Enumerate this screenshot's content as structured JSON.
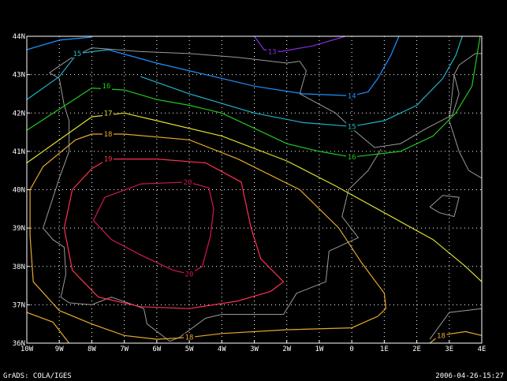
{
  "footer": {
    "left": "GrADS: COLA/IGES",
    "right": "2006-04-26-15:27"
  },
  "colors": {
    "background": "#000000",
    "frame": "#ffffff",
    "grid": "#ffffff",
    "coastline": "#9a9a9a",
    "levels": {
      "13": "#8a2be2",
      "14": "#1e90ff",
      "15": "#20b2c8",
      "16": "#22c81e",
      "17": "#dede2c",
      "18": "#e6a92c",
      "19": "#ff3050",
      "20": "#d11a4a"
    }
  },
  "chart_data": {
    "type": "contour",
    "title": "",
    "xlabel": "",
    "ylabel": "",
    "xlim": [
      -10,
      4
    ],
    "ylim": [
      36,
      44
    ],
    "grid": true,
    "x_ticks": [
      {
        "value": -10,
        "label": "10W"
      },
      {
        "value": -9,
        "label": "9W"
      },
      {
        "value": -8,
        "label": "8W"
      },
      {
        "value": -7,
        "label": "7W"
      },
      {
        "value": -6,
        "label": "6W"
      },
      {
        "value": -5,
        "label": "5W"
      },
      {
        "value": -4,
        "label": "4W"
      },
      {
        "value": -3,
        "label": "3W"
      },
      {
        "value": -2,
        "label": "2W"
      },
      {
        "value": -1,
        "label": "1W"
      },
      {
        "value": 0,
        "label": "0"
      },
      {
        "value": 1,
        "label": "1E"
      },
      {
        "value": 2,
        "label": "2E"
      },
      {
        "value": 3,
        "label": "3E"
      },
      {
        "value": 4,
        "label": "4E"
      }
    ],
    "y_ticks": [
      {
        "value": 36,
        "label": "36N"
      },
      {
        "value": 37,
        "label": "37N"
      },
      {
        "value": 38,
        "label": "38N"
      },
      {
        "value": 39,
        "label": "39N"
      },
      {
        "value": 40,
        "label": "40N"
      },
      {
        "value": 41,
        "label": "41N"
      },
      {
        "value": 42,
        "label": "42N"
      },
      {
        "value": 43,
        "label": "43N"
      },
      {
        "value": 44,
        "label": "44N"
      }
    ],
    "contours": [
      {
        "level": "13",
        "label": "13",
        "labels_at": [
          [
            -2.45,
            43.6
          ]
        ],
        "paths": [
          [
            [
              -3.0,
              44.0
            ],
            [
              -2.7,
              43.65
            ],
            [
              -2.2,
              43.6
            ],
            [
              -1.2,
              43.75
            ],
            [
              -0.2,
              44.0
            ]
          ]
        ]
      },
      {
        "level": "14",
        "label": "14",
        "labels_at": [
          [
            0.0,
            42.45
          ]
        ],
        "paths": [
          [
            [
              -10.0,
              43.65
            ],
            [
              -9.0,
              43.9
            ],
            [
              -8.0,
              43.98
            ]
          ],
          [
            [
              -7.5,
              43.65
            ],
            [
              -6.0,
              43.3
            ],
            [
              -4.5,
              43.0
            ],
            [
              -3.0,
              42.7
            ],
            [
              -1.5,
              42.5
            ],
            [
              0.0,
              42.45
            ],
            [
              0.5,
              42.55
            ],
            [
              0.8,
              42.9
            ],
            [
              1.2,
              43.5
            ],
            [
              1.45,
              44.0
            ]
          ]
        ]
      },
      {
        "level": "15",
        "label": "15",
        "labels_at": [
          [
            -8.45,
            43.55
          ],
          [
            0.0,
            41.65
          ]
        ],
        "paths": [
          [
            [
              -10.0,
              42.35
            ],
            [
              -9.0,
              42.95
            ],
            [
              -8.45,
              43.55
            ],
            [
              -7.5,
              43.65
            ]
          ],
          [
            [
              -6.5,
              42.95
            ],
            [
              -5.0,
              42.5
            ],
            [
              -3.0,
              42.0
            ],
            [
              -1.5,
              41.75
            ],
            [
              0.0,
              41.65
            ],
            [
              1.0,
              41.8
            ],
            [
              2.0,
              42.2
            ],
            [
              2.8,
              42.9
            ],
            [
              3.2,
              43.5
            ],
            [
              3.4,
              44.0
            ]
          ]
        ]
      },
      {
        "level": "16",
        "label": "16",
        "labels_at": [
          [
            -7.55,
            42.7
          ],
          [
            0.0,
            40.85
          ]
        ],
        "paths": [
          [
            [
              -10.0,
              41.55
            ],
            [
              -9.0,
              42.1
            ],
            [
              -8.0,
              42.65
            ],
            [
              -7.0,
              42.6
            ],
            [
              -6.0,
              42.35
            ],
            [
              -5.0,
              42.2
            ],
            [
              -4.0,
              42.0
            ],
            [
              -3.0,
              41.6
            ],
            [
              -2.0,
              41.2
            ],
            [
              -1.0,
              41.0
            ],
            [
              0.0,
              40.85
            ],
            [
              1.5,
              41.0
            ],
            [
              2.5,
              41.4
            ],
            [
              3.2,
              42.0
            ],
            [
              3.7,
              42.7
            ],
            [
              3.95,
              44.0
            ]
          ]
        ]
      },
      {
        "level": "17",
        "label": "17",
        "labels_at": [
          [
            -7.5,
            42.0
          ]
        ],
        "paths": [
          [
            [
              -10.0,
              40.7
            ],
            [
              -9.0,
              41.3
            ],
            [
              -8.0,
              41.9
            ],
            [
              -7.0,
              42.0
            ],
            [
              -6.0,
              41.8
            ],
            [
              -4.0,
              41.4
            ],
            [
              -2.0,
              40.75
            ],
            [
              -0.5,
              40.1
            ],
            [
              1.0,
              39.4
            ],
            [
              2.5,
              38.7
            ],
            [
              3.5,
              38.0
            ],
            [
              4.0,
              37.6
            ]
          ]
        ]
      },
      {
        "level": "18",
        "label": "18",
        "labels_at": [
          [
            -7.5,
            41.45
          ],
          [
            -5.0,
            36.15
          ],
          [
            2.75,
            36.2
          ]
        ],
        "paths": [
          [
            [
              -8.0,
              41.45
            ],
            [
              -7.0,
              41.45
            ],
            [
              -5.0,
              41.3
            ],
            [
              -3.5,
              40.8
            ],
            [
              -1.6,
              40.0
            ],
            [
              -0.4,
              39.0
            ],
            [
              0.3,
              38.1
            ],
            [
              1.0,
              37.3
            ],
            [
              1.05,
              36.9
            ],
            [
              0.8,
              36.7
            ],
            [
              0.0,
              36.4
            ],
            [
              -2.0,
              36.35
            ],
            [
              -4.0,
              36.25
            ],
            [
              -5.0,
              36.15
            ],
            [
              -6.0,
              36.1
            ],
            [
              -7.0,
              36.2
            ],
            [
              -8.0,
              36.5
            ],
            [
              -9.0,
              36.85
            ],
            [
              -9.8,
              37.6
            ],
            [
              -9.9,
              38.8
            ],
            [
              -9.9,
              40.0
            ],
            [
              -9.5,
              40.6
            ],
            [
              -8.5,
              41.3
            ],
            [
              -8.0,
              41.45
            ]
          ],
          [
            [
              -10.0,
              36.8
            ],
            [
              -9.2,
              36.55
            ],
            [
              -8.7,
              36.0
            ]
          ],
          [
            [
              2.4,
              36.0
            ],
            [
              2.7,
              36.2
            ],
            [
              3.5,
              36.3
            ],
            [
              4.0,
              36.2
            ]
          ]
        ]
      },
      {
        "level": "19",
        "label": "19",
        "labels_at": [
          [
            -7.5,
            40.8
          ]
        ],
        "paths": [
          [
            [
              -7.5,
              40.8
            ],
            [
              -6.0,
              40.8
            ],
            [
              -4.5,
              40.7
            ],
            [
              -3.4,
              40.2
            ],
            [
              -3.1,
              39.0
            ],
            [
              -2.8,
              38.2
            ],
            [
              -2.1,
              37.6
            ],
            [
              -2.5,
              37.35
            ],
            [
              -3.5,
              37.1
            ],
            [
              -5.0,
              36.9
            ],
            [
              -6.5,
              36.95
            ],
            [
              -7.8,
              37.2
            ],
            [
              -8.6,
              37.9
            ],
            [
              -8.85,
              39.0
            ],
            [
              -8.6,
              40.0
            ],
            [
              -8.0,
              40.55
            ],
            [
              -7.5,
              40.8
            ]
          ]
        ]
      },
      {
        "level": "20",
        "label": "20",
        "labels_at": [
          [
            -5.05,
            40.2
          ],
          [
            -5.0,
            37.8
          ]
        ],
        "paths": [
          [
            [
              -5.05,
              40.2
            ],
            [
              -6.5,
              40.15
            ],
            [
              -7.6,
              39.8
            ],
            [
              -7.95,
              39.2
            ],
            [
              -7.4,
              38.7
            ],
            [
              -6.5,
              38.3
            ],
            [
              -5.5,
              37.9
            ],
            [
              -5.0,
              37.8
            ],
            [
              -4.6,
              38.0
            ],
            [
              -4.35,
              38.8
            ],
            [
              -4.25,
              39.5
            ],
            [
              -4.4,
              40.05
            ],
            [
              -5.05,
              40.2
            ]
          ]
        ]
      }
    ],
    "coastline": [
      [
        [
          -9.0,
          42.9
        ],
        [
          -9.3,
          43.05
        ],
        [
          -8.7,
          43.4
        ],
        [
          -8.0,
          43.7
        ],
        [
          -6.5,
          43.6
        ],
        [
          -5.0,
          43.55
        ],
        [
          -3.5,
          43.45
        ],
        [
          -2.0,
          43.3
        ],
        [
          -1.6,
          43.35
        ]
      ],
      [
        [
          -1.6,
          43.35
        ],
        [
          -1.4,
          43.1
        ],
        [
          -1.6,
          42.5
        ],
        [
          -0.5,
          42.0
        ],
        [
          0.0,
          41.6
        ],
        [
          0.7,
          41.1
        ],
        [
          1.5,
          41.2
        ],
        [
          2.3,
          41.6
        ],
        [
          3.1,
          41.95
        ],
        [
          3.3,
          42.5
        ],
        [
          3.15,
          43.0
        ],
        [
          3.3,
          43.25
        ],
        [
          3.8,
          43.55
        ],
        [
          4.0,
          43.55
        ]
      ],
      [
        [
          -9.0,
          42.9
        ],
        [
          -8.85,
          42.2
        ],
        [
          -8.7,
          41.8
        ],
        [
          -8.7,
          41.0
        ],
        [
          -9.0,
          40.3
        ],
        [
          -9.5,
          39.0
        ],
        [
          -9.2,
          38.7
        ],
        [
          -8.85,
          38.5
        ],
        [
          -8.8,
          37.8
        ],
        [
          -8.95,
          37.2
        ],
        [
          -8.7,
          37.05
        ],
        [
          -8.0,
          37.0
        ],
        [
          -7.4,
          37.2
        ],
        [
          -6.4,
          36.9
        ],
        [
          -6.3,
          36.5
        ],
        [
          -5.6,
          36.05
        ],
        [
          -5.3,
          36.15
        ],
        [
          -4.5,
          36.65
        ],
        [
          -4.0,
          36.75
        ],
        [
          -3.0,
          36.75
        ],
        [
          -2.1,
          36.75
        ],
        [
          -1.7,
          37.3
        ],
        [
          -0.8,
          37.6
        ],
        [
          -0.7,
          38.4
        ],
        [
          0.2,
          38.75
        ],
        [
          -0.3,
          39.3
        ],
        [
          -0.1,
          40.0
        ],
        [
          0.5,
          40.5
        ],
        [
          0.9,
          41.05
        ]
      ],
      [
        [
          2.4,
          39.55
        ],
        [
          2.8,
          39.85
        ],
        [
          3.3,
          39.8
        ],
        [
          3.15,
          39.3
        ],
        [
          2.7,
          39.4
        ],
        [
          2.4,
          39.55
        ]
      ],
      [
        [
          2.4,
          36.1
        ],
        [
          3.0,
          36.8
        ],
        [
          4.0,
          36.9
        ]
      ],
      [
        [
          3.15,
          43.0
        ],
        [
          3.0,
          41.8
        ],
        [
          3.3,
          41.0
        ],
        [
          3.6,
          40.5
        ],
        [
          4.0,
          40.3
        ]
      ]
    ]
  }
}
